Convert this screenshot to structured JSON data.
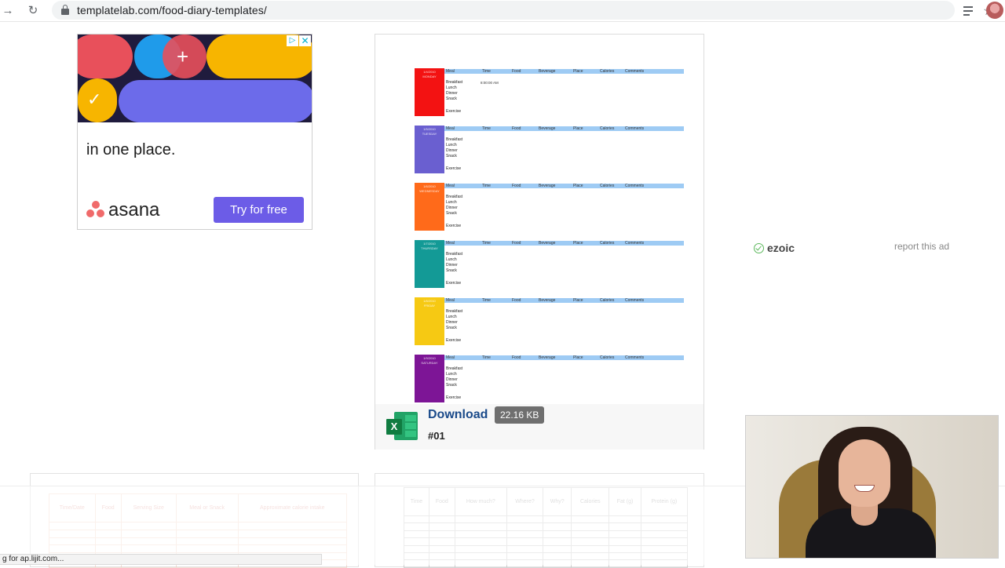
{
  "browser": {
    "url": "templatelab.com/food-diary-templates/",
    "icons": [
      "forward-icon",
      "reload-icon",
      "lock-icon",
      "star-icon",
      "reading-list-icon",
      "profile-avatar"
    ]
  },
  "ad": {
    "headline": "in one place.",
    "brand": "asana",
    "cta": "Try for free",
    "adchoices_play": "▷",
    "adchoices_close": "✕"
  },
  "template_card": {
    "download_label": "Download",
    "file_size": "22.16 KB",
    "number": "#01",
    "file_type_badge": "X",
    "sheet": {
      "columns": [
        "Meal",
        "Time",
        "Food",
        "Beverage",
        "Place",
        "Calories",
        "Comments"
      ],
      "meals": [
        "Breakfast",
        "Lunch",
        "Dinner",
        "Snack"
      ],
      "exercise_label": "Exercise",
      "first_time_entry": "8:00:00 AM",
      "days": [
        {
          "date": "1/4/2010",
          "name": "MONDAY",
          "color": "#f31212"
        },
        {
          "date": "1/5/2010",
          "name": "TUESDAY",
          "color": "#6a5fd0"
        },
        {
          "date": "1/6/2010",
          "name": "WEDNESDAY",
          "color": "#ff6a1a"
        },
        {
          "date": "1/7/2010",
          "name": "THURSDAY",
          "color": "#139a96"
        },
        {
          "date": "1/8/2010",
          "name": "FRIDAY",
          "color": "#f6c913"
        },
        {
          "date": "1/9/2010",
          "name": "SATURDAY",
          "color": "#7d1596"
        }
      ]
    }
  },
  "right_ad": {
    "brand": "ezoic",
    "report_link": "report this ad"
  },
  "bottom_cards": {
    "left_headers": [
      "Time/Date",
      "Food",
      "Serving Size",
      "Meal or Snack",
      "Approximate calorie intake"
    ],
    "right_headers": [
      "Time",
      "Food",
      "How much?",
      "Where?",
      "Why?",
      "Calories",
      "Fat (g)",
      "Protein (g)"
    ]
  },
  "status_bar": {
    "text": "g for ap.lijit.com..."
  },
  "colors": {
    "accent_purple": "#6c5ce7",
    "link_blue": "#1a4a8a",
    "excel_green": "#107c41",
    "sheet_header_blue": "#9ecbf4"
  }
}
